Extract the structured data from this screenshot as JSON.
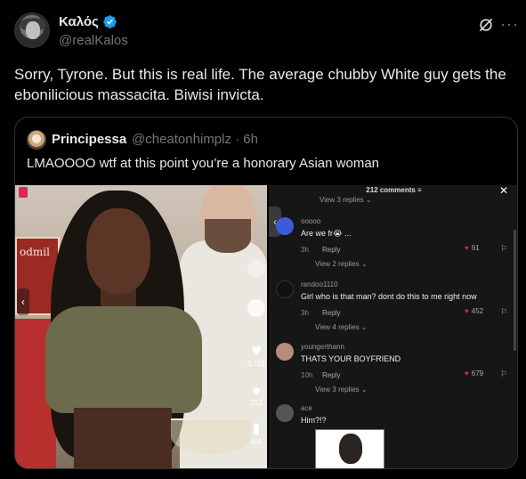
{
  "author": {
    "display_name": "Καλός",
    "handle": "@realKalos",
    "verified": true
  },
  "post": {
    "text": "Sorry, Tyrone. But this is real life. The average chubby White guy gets the ebonilicious massacita. Biwisi invicta."
  },
  "header_icons": [
    "grok-icon",
    "more-icon"
  ],
  "quote": {
    "display_name": "Principessa",
    "handle_time": "@cheatonhimplz · 6h",
    "text": "LMAOOOO wtf at this point you’re a honorary Asian woman"
  },
  "video": {
    "poster_text": "odmil",
    "side_counts": [
      "6,116",
      "212",
      "405"
    ]
  },
  "comments_panel": {
    "header": "212 comments ≡",
    "close": "✕",
    "top_view_replies": "View 3 replies ⌄",
    "items": [
      {
        "user": "ooooo",
        "text": "Are we fr😭 ...",
        "age": "3h",
        "reply": "Reply",
        "likes": "91",
        "view_replies": "View 2 replies ⌄",
        "avatar_color": "#3b5bdb"
      },
      {
        "user": "randoo1110",
        "text": "Girl who is that man? dont do this to me right now",
        "age": "3h",
        "reply": "Reply",
        "likes": "452",
        "view_replies": "View 4 replies ⌄",
        "avatar_color": "#111111"
      },
      {
        "user": "youngerthann",
        "text": "THATS YOUR BOYFRIEND",
        "age": "10h",
        "reply": "Reply",
        "likes": "679",
        "view_replies": "View 3 replies ⌄",
        "avatar_color": "#b88a7a"
      },
      {
        "user": "ace",
        "text": "Him?!?",
        "avatar_color": "#555555"
      }
    ]
  }
}
